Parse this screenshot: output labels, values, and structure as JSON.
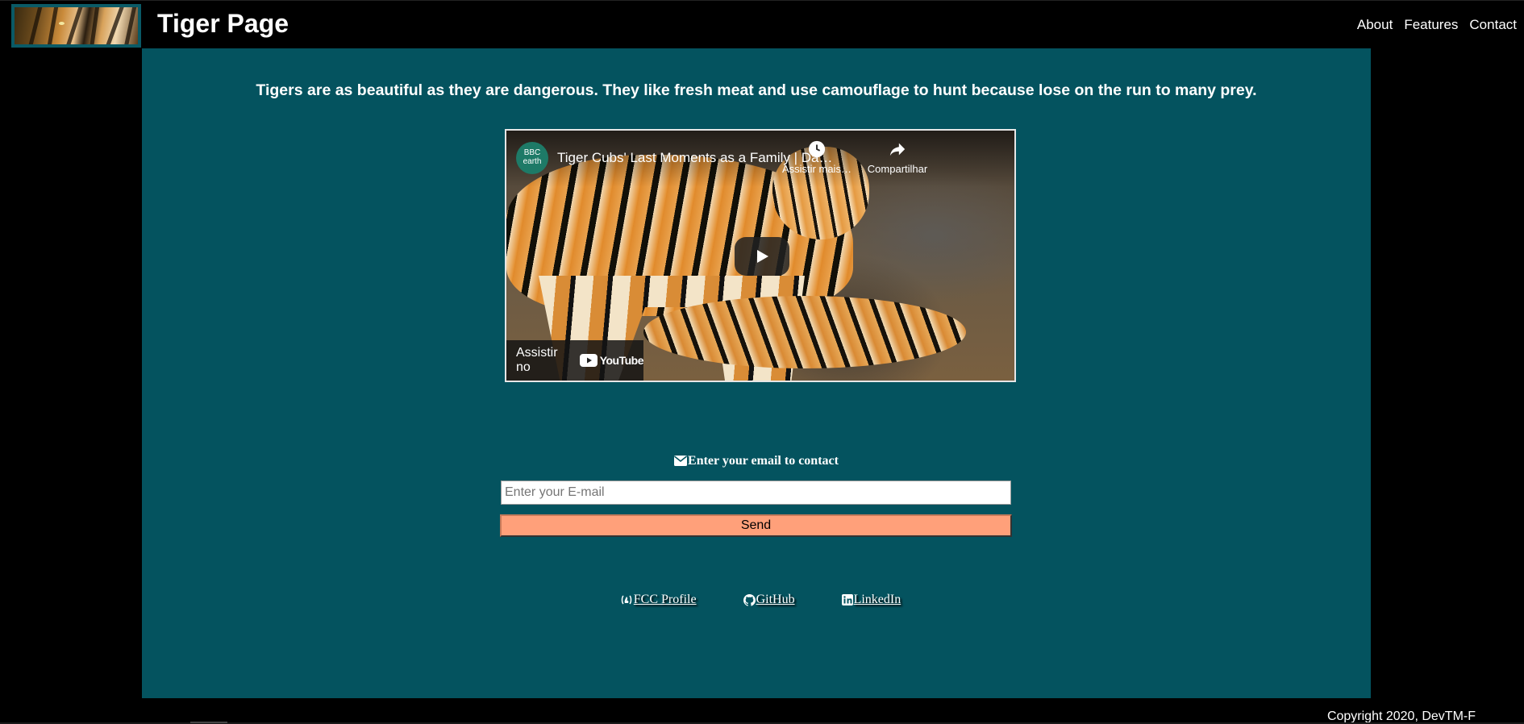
{
  "header": {
    "site_title": "Tiger Page",
    "nav": [
      {
        "label": "About"
      },
      {
        "label": "Features"
      },
      {
        "label": "Contact"
      }
    ]
  },
  "main": {
    "intro_text": "Tigers are as beautiful as they are dangerous. They like fresh meat and use camouflage to hunt because lose on the run to many prey.",
    "video": {
      "channel_logo_top": "BBC",
      "channel_logo_bottom": "earth",
      "title": "Tiger Cubs' Last Moments as a Family | Dawn of the Tiger",
      "watch_later_label": "Assistir mais tarde",
      "share_label": "Compartilhar",
      "watch_on_label": "Assistir no",
      "youtube_label": "YouTube"
    },
    "contact": {
      "label": "Enter your email to contact",
      "email_placeholder": "Enter your E-mail",
      "send_label": "Send"
    },
    "links": [
      {
        "label": "FCC Profile",
        "icon": "free-code-camp-icon"
      },
      {
        "label": "GitHub",
        "icon": "github-icon"
      },
      {
        "label": "LinkedIn",
        "icon": "linkedin-icon"
      }
    ]
  },
  "footer": {
    "copyright": "Copyright 2020, DevTM-F"
  },
  "colors": {
    "background": "#000000",
    "main_panel": "#04535f",
    "send_button": "#ffa07a",
    "logo_border": "#0a5a66"
  }
}
